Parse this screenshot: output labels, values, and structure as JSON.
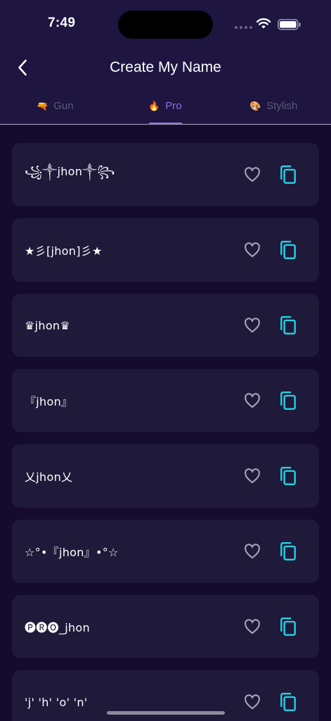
{
  "status_bar": {
    "time": "7:49"
  },
  "header": {
    "title": "Create My Name",
    "back_icon": "chevron-left-icon"
  },
  "tabs": [
    {
      "label": "Gun",
      "icon": "🔫",
      "active": false
    },
    {
      "label": "Pro",
      "icon": "🔥",
      "active": true
    },
    {
      "label": "Stylish",
      "icon": "🎨",
      "active": false
    }
  ],
  "names": [
    {
      "text": "꧁༒jhon༒꧂"
    },
    {
      "text": "★彡[jhon]彡★"
    },
    {
      "text": "♛jhon♛"
    },
    {
      "text": "『jhon』"
    },
    {
      "text": "乂jhon乂"
    },
    {
      "text": "☆°•『jhon』•°☆"
    },
    {
      "text": "🅟🅡🅞_jhon"
    },
    {
      "text": "'j' 'h' 'o' 'n'"
    }
  ],
  "colors": {
    "background": "#150b2e",
    "header_bg": "#1e1541",
    "card_bg": "#1f1a3a",
    "accent": "#8a6fdc",
    "copy_icon": "#22d3e6",
    "heart_icon": "#a9a6b8"
  }
}
